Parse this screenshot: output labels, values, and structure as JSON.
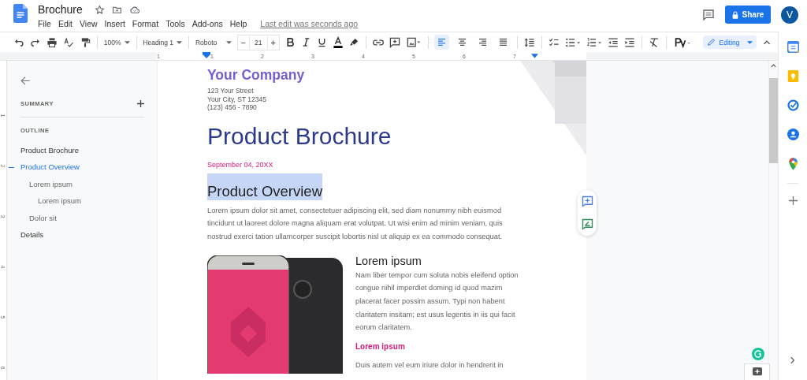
{
  "header": {
    "title": "Brochure",
    "menu": [
      "File",
      "Edit",
      "View",
      "Insert",
      "Format",
      "Tools",
      "Add-ons",
      "Help"
    ],
    "last_edit": "Last edit was seconds ago",
    "share": "Share",
    "avatar": "V"
  },
  "toolbar": {
    "zoom": "100%",
    "style": "Heading 1",
    "font": "Roboto",
    "size_minus": "−",
    "font_size": "21",
    "size_plus": "+",
    "align_buttons": [
      {
        "selected": true
      },
      {
        "selected": false
      },
      {
        "selected": false
      },
      {
        "selected": false
      }
    ],
    "mode": "Editing"
  },
  "ruler": {
    "marks": [
      "1",
      "1",
      "2",
      "3",
      "4",
      "5",
      "6",
      "7"
    ],
    "vertical_marks": [
      "1",
      "2",
      "3",
      "4",
      "5",
      "6"
    ]
  },
  "outline_panel": {
    "summary_label": "SUMMARY",
    "outline_label": "OUTLINE",
    "items": [
      {
        "label": "Product Brochure",
        "selected": false
      },
      {
        "label": "Product Overview",
        "selected": true,
        "children": [
          {
            "label": "Lorem ipsum",
            "selected": false,
            "children": [
              {
                "label": "Lorem ipsum",
                "selected": false
              }
            ]
          },
          {
            "label": "Dolor sit",
            "selected": false
          }
        ]
      },
      {
        "label": "Details",
        "selected": false
      }
    ]
  },
  "document": {
    "company": "Your Company",
    "address": [
      "123 Your Street",
      "Your City, ST 12345",
      "(123) 456 - 7890"
    ],
    "title": "Product Brochure",
    "date": "September 04, 20XX",
    "heading": {
      "text": "Product Overview",
      "selected": true
    },
    "intro": "Lorem ipsum dolor sit amet, consectetuer adipiscing elit, sed diam nonummy nibh euismod tincidunt ut laoreet dolore magna aliquam erat volutpat. Ut wisi enim ad minim veniam, quis nostrud exerci tation ullamcorper suscipit lobortis nisl ut aliquip ex ea commodo consequat.",
    "subheading": "Lorem ipsum",
    "body": "Nam liber tempor cum soluta nobis eleifend option congue nihil imperdiet doming id quod mazim placerat facer possim assum. Typi non habent claritatem insitam; est usus legentis in iis qui facit eorum claritatem.",
    "minor_heading": "Lorem ipsum",
    "body_cut": "Duis autem vel eum iriure dolor in hendrerit in"
  }
}
